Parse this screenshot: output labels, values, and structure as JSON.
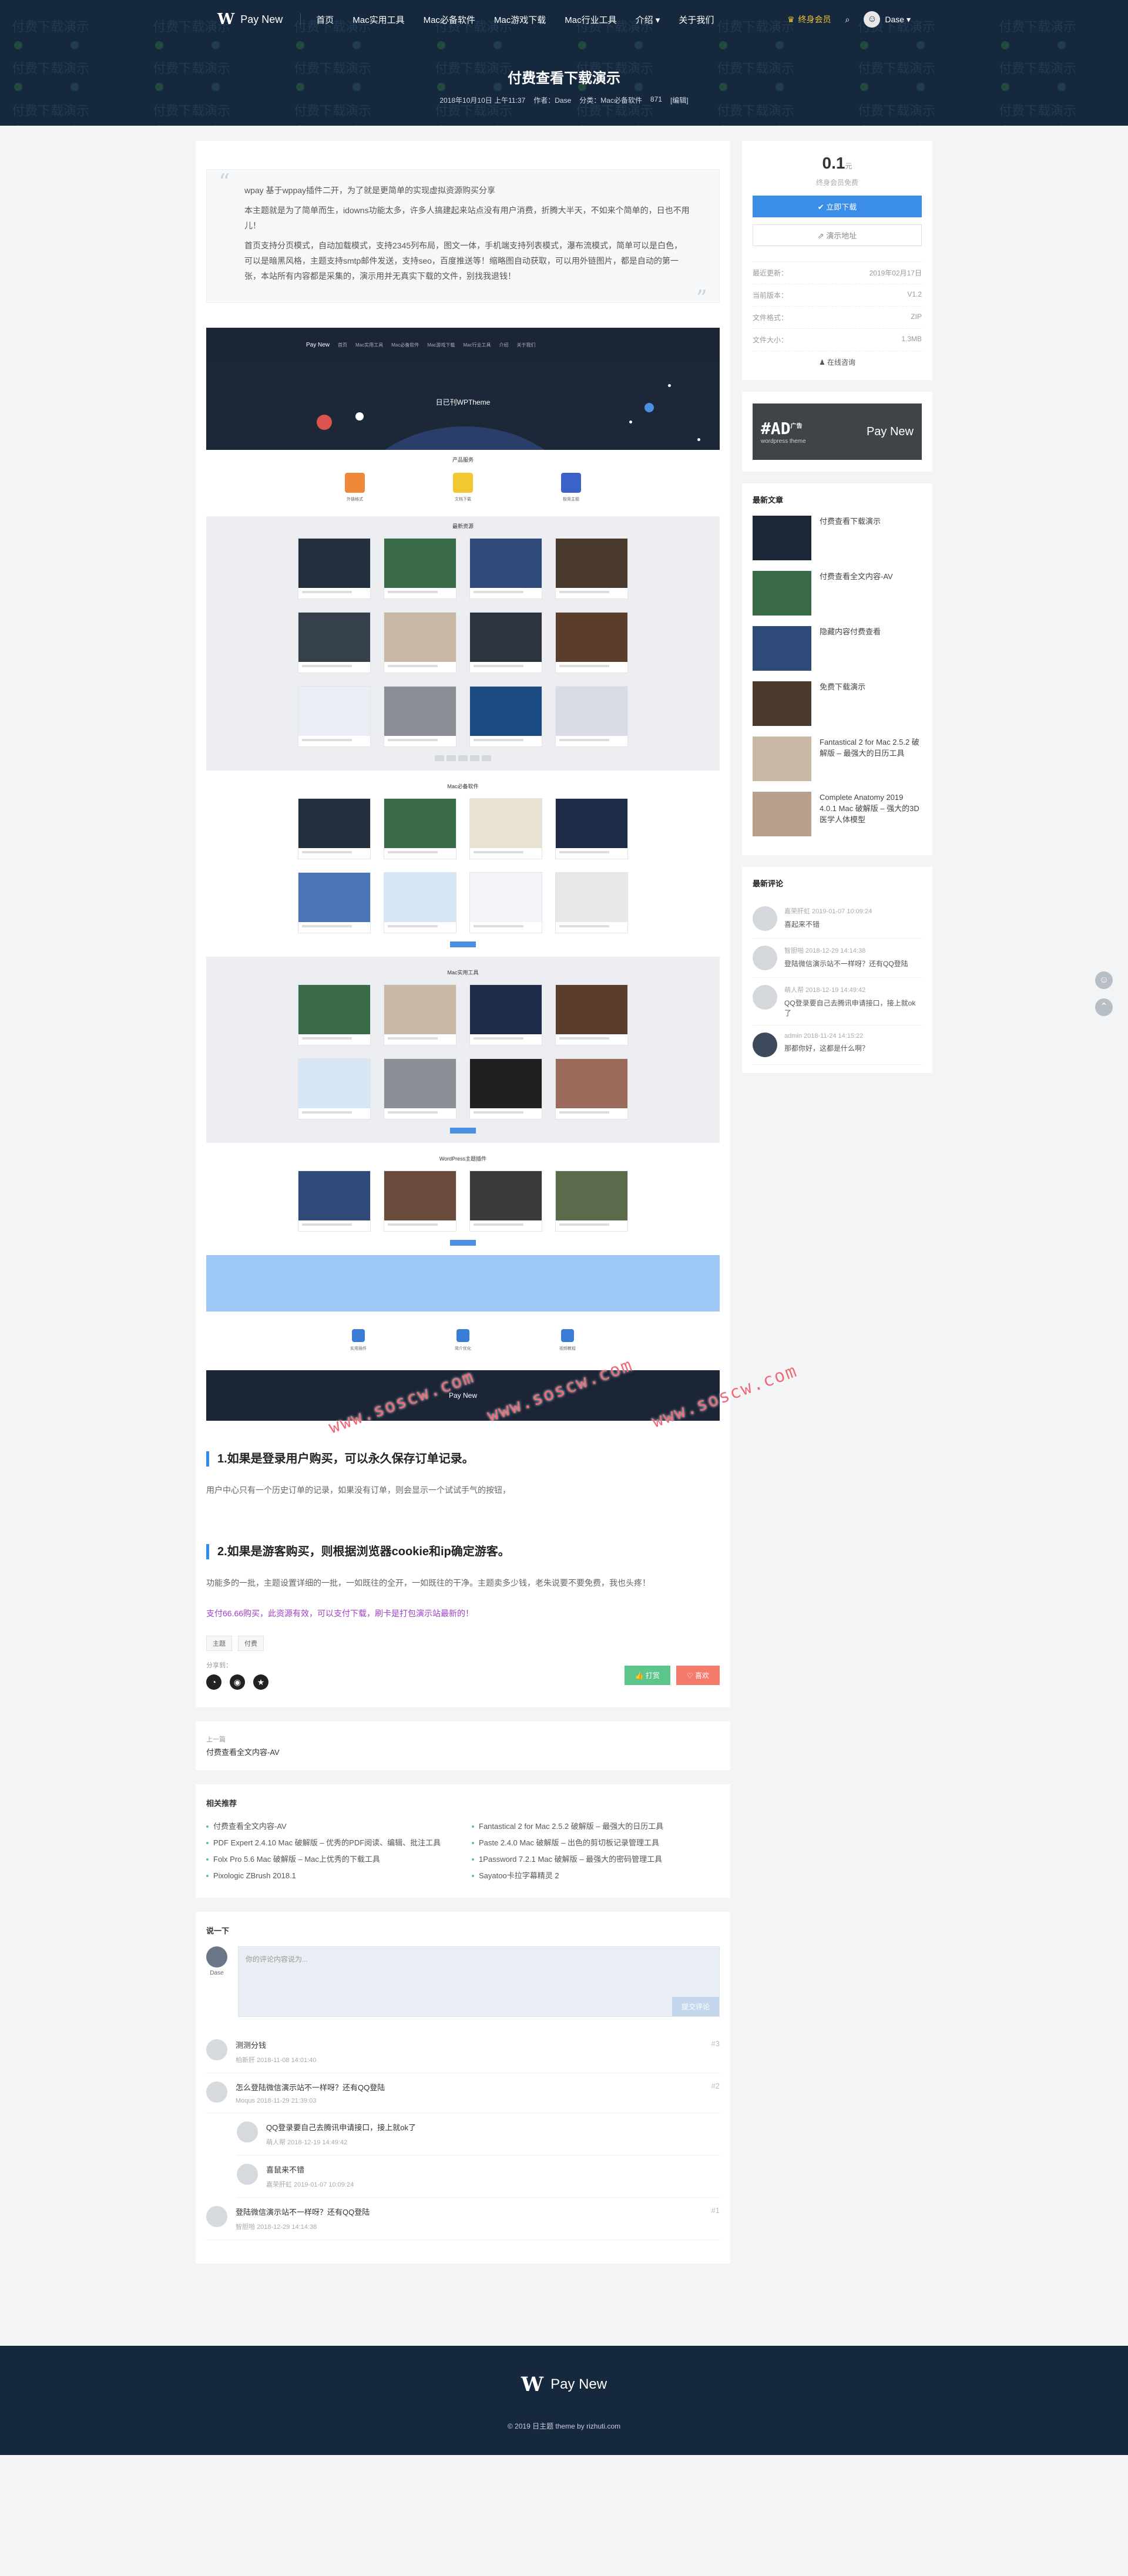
{
  "colors": {
    "nav_bg": "#16283d",
    "accent": "#2d8cf0",
    "vip": "#f0c330",
    "like": "#5cc58b",
    "fav": "#f47a6c",
    "purple": "#a040c8"
  },
  "site": {
    "logo_mark": "W",
    "logo_text": "Pay New"
  },
  "nav": {
    "items": [
      "首页",
      "Mac实用工具",
      "Mac必备软件",
      "Mac游戏下载",
      "Mac行业工具",
      "介绍 ▾",
      "关于我们"
    ],
    "vip": "终身会员",
    "user": "Dase ▾"
  },
  "hero": {
    "pattern_text": "付费下载演示",
    "title": "付费查看下载演示",
    "meta": {
      "date": "2018年10月10日 上午11:37",
      "author": "作者：Dase",
      "category": "分类：Mac必备软件",
      "views": "871",
      "edit": "[编辑]"
    }
  },
  "article": {
    "quote": [
      "wpay 基于wppay插件二开，为了就是更简单的实现虚拟资源购买分享",
      "本主题就是为了简单而生，idowns功能太多，许多人搞建起来站点没有用户消费，折腾大半天，不如来个简单的，日也不用儿！",
      "首页支持分页模式，自动加载模式，支持2345列布局，图文一体，手机端支持列表模式，瀑布流模式，简单可以是白色，可以是暗黑风格，主题支持smtp邮件发送，支持seo，百度推送等！缩略图自动获取，可以用外链图片，都是自动的第一张，本站所有内容都是采集的，演示用并无真实下载的文件，别找我退钱！"
    ],
    "shot": {
      "nav_items": [
        "首页",
        "Mac实用工具",
        "Mac必备软件",
        "Mac游戏下载",
        "Mac行业工具",
        "介绍",
        "关于我们"
      ],
      "hero_title": "日已刊WPTheme",
      "sec1": "产品服务",
      "sec2": "最新资源",
      "sec3": "Mac必备软件",
      "sec4": "Mac实用工具",
      "sec5": "WordPress主题插件",
      "feats": [
        "外链格式",
        "文档下载",
        "极简主题"
      ],
      "foot_feats": [
        "实用插件",
        "简介优化",
        "视频教程"
      ],
      "footer_logo": "Pay New"
    },
    "watermark": "www.soscw.com",
    "h1": "1.如果是登录用户购买，可以永久保存订单记录。",
    "p1": "用户中心只有一个历史订单的记录，如果没有订单，则会显示一个试试手气的按钮，",
    "h2": "2.如果是游客购买，则根据浏览器cookie和ip确定游客。",
    "p2": "功能多的一批，主题设置详细的一批，一如既往的全开，一如既往的干净。主题卖多少钱，老朱说要不要免费，我也头疼！",
    "p3": "支付66.66购买，此资源有效，可以支付下载，刷卡是打包演示站最新的！",
    "tags": [
      "主题",
      "付费"
    ],
    "share_label": "分享到：",
    "share_icons": [
      "wechat-icon",
      "weibo-icon",
      "qzone-icon"
    ],
    "like": "👍 打赏",
    "fav": "♡ 喜欢"
  },
  "prev": {
    "label": "上一篇",
    "title": "付费查看全文内容-AV"
  },
  "related": {
    "title": "相关推荐",
    "items": [
      "付费查看全文内容-AV",
      "Fantastical 2 for Mac 2.5.2 破解版 – 最强大的日历工具",
      "PDF Expert 2.4.10 Mac 破解版 – 优秀的PDF阅读、编辑、批注工具",
      "Paste 2.4.0 Mac 破解版 – 出色的剪切板记录管理工具",
      "Folx Pro 5.6 Mac 破解版 – Mac上优秀的下载工具",
      "1Password 7.2.1 Mac 破解版 – 最强大的密码管理工具",
      "Pixologic ZBrush 2018.1",
      "Sayatoo卡拉字幕精灵 2"
    ]
  },
  "comments": {
    "title": "说一下",
    "placeholder": "你的评论内容说为...",
    "submit": "提交评论",
    "user": "Dase",
    "list": [
      {
        "text": "测测分钱",
        "meta": "柏新肝  2018-11-08 14:01:40",
        "floor": "#3",
        "child": false,
        "admin": false
      },
      {
        "text": "怎么登陆微信演示站不一样呀？还有QQ登陆",
        "meta": "Moqus  2018-11-29 21:39:03",
        "floor": "#2",
        "child": false,
        "admin": false
      },
      {
        "text": "QQ登录要自己去腾讯申请接口，接上就ok了",
        "meta": "萌人帮  2018-12-19 14:49:42",
        "floor": "",
        "child": true,
        "admin": false
      },
      {
        "text": "喜鼠来不错",
        "meta": "嘉荣肝虹  2019-01-07 10:09:24",
        "floor": "",
        "child": true,
        "admin": false
      },
      {
        "text": "登陆微信演示站不一样呀？还有QQ登陆",
        "meta": "智胆啪  2018-12-29 14:14:38",
        "floor": "#1",
        "child": false,
        "admin": false
      }
    ]
  },
  "sidebar": {
    "price": "0.1",
    "unit": "元",
    "price_sub": "终身会员免费",
    "buy": "✔ 立即下载",
    "demo": "⇗ 演示地址",
    "info": [
      [
        "最近更新：",
        "2019年02月17日"
      ],
      [
        "当前版本：",
        "V1.2"
      ],
      [
        "文件格式：",
        "ZIP"
      ],
      [
        "文件大小：",
        "1.3MB"
      ]
    ],
    "consult": "♟ 在线咨询",
    "ad": {
      "big": "#AD",
      "big_sup": "广告",
      "small": "wordpress theme",
      "right": "Pay New"
    },
    "latest_title": "最新文章",
    "latest": [
      "付费查看下载演示",
      "付费查看全文内容-AV",
      "隐藏内容付费查看",
      "免费下载演示",
      "Fantastical 2 for Mac 2.5.2 破解版 – 最强大的日历工具",
      "Complete Anatomy 2019 4.0.1 Mac 破解版 – 强大的3D医学人体模型"
    ],
    "rc_title": "最新评论",
    "rc": [
      {
        "meta": "嘉荣肝虹  2019-01-07 10:09:24",
        "text": "喜起来不错",
        "admin": false
      },
      {
        "meta": "智胆啪  2018-12-29 14:14:38",
        "text": "登陆微信演示站不一样呀？还有QQ登陆",
        "admin": false
      },
      {
        "meta": "萌人帮  2018-12-19 14:49:42",
        "text": "QQ登录要自己去腾讯申请接口，接上就ok了",
        "admin": false
      },
      {
        "meta": "admin  2018-11-24 14:15:22",
        "text": "那都你好，这都是什么啊？",
        "admin": true
      }
    ]
  },
  "footer": {
    "logo_mark": "W",
    "logo_text": "Pay New",
    "copy": "© 2019 日主题    theme by rizhuti.com"
  }
}
